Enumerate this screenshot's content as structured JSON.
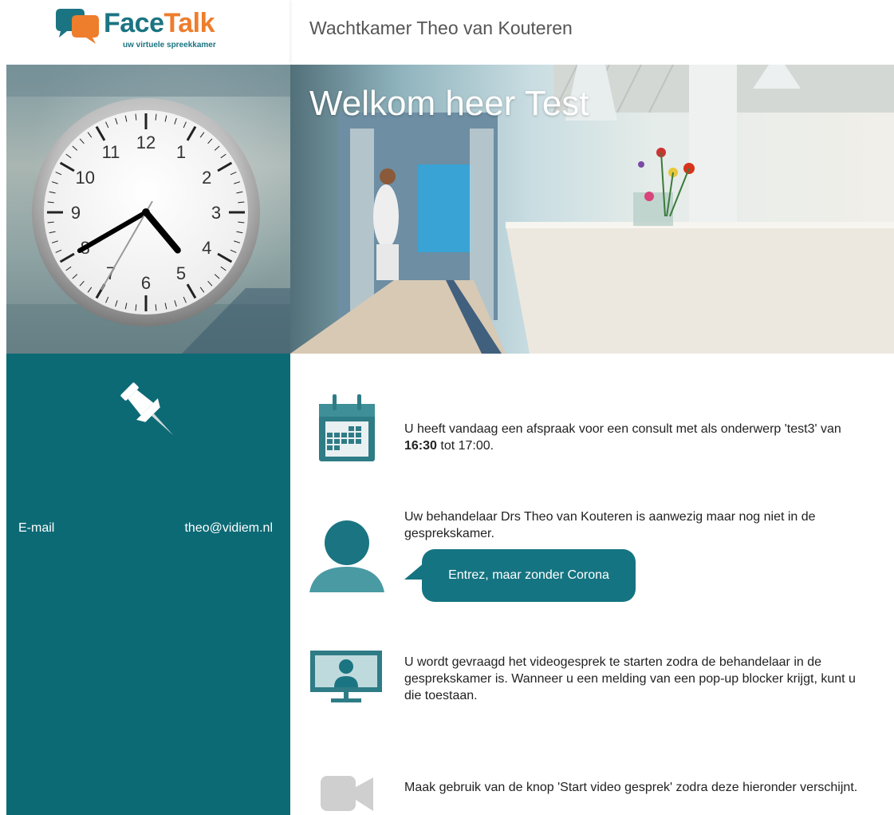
{
  "header": {
    "logo": {
      "word_part1": "Face",
      "word_part2": "Talk",
      "tagline": "uw virtuele spreekkamer"
    },
    "room_title": "Wachtkamer Theo van Kouteren"
  },
  "hero": {
    "greeting": "Welkom heer Test"
  },
  "clock": {
    "numerals": [
      "12",
      "1",
      "2",
      "3",
      "4",
      "5",
      "6",
      "7",
      "8",
      "9",
      "10",
      "11"
    ],
    "hour": 4,
    "minute": 40,
    "second": 35
  },
  "sidebar": {
    "email_label": "E-mail",
    "email_value": "theo@vidiem.nl",
    "pin_icon": "pushpin-icon"
  },
  "rows": {
    "appointment": {
      "icon": "calendar-icon",
      "text_before": "U heeft vandaag een afspraak voor een consult met als onderwerp 'test3' van ",
      "start_time": "16:30",
      "text_after": " tot 17:00."
    },
    "practitioner": {
      "icon": "person-icon",
      "text": "Uw behandelaar Drs Theo van Kouteren is aanwezig maar nog niet in de gesprekskamer.",
      "message": "Entrez, maar zonder Corona"
    },
    "video_request": {
      "icon": "monitor-person-icon",
      "text": "U wordt gevraagd het videogesprek te starten zodra de behandelaar in de gesprekskamer is. Wanneer u een melding van een pop-up blocker krijgt, kunt u die toestaan."
    },
    "start_hint": {
      "icon": "video-camera-icon",
      "text": "Maak gebruik van de knop 'Start video gesprek' zodra deze hieronder verschijnt."
    }
  },
  "colors": {
    "teal_dark": "#0c6a75",
    "teal": "#1b7482",
    "orange": "#ee7d2c",
    "icon_grey": "#cfcfcf"
  }
}
